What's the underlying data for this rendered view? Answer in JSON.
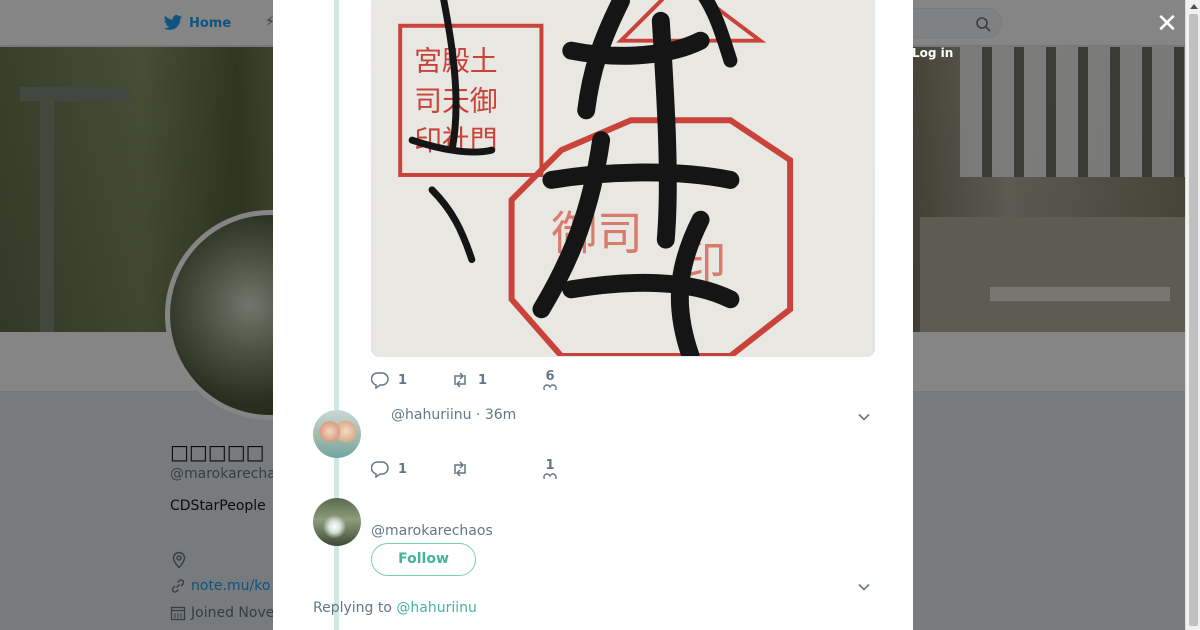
{
  "nav": {
    "home_label": "Home",
    "login_label": "Log in"
  },
  "profile": {
    "name": "□□□□□",
    "handle": "@marokarecha",
    "bio": "CDStarPeople",
    "link": "note.mu/ko",
    "joined": "Joined Nove"
  },
  "thread": {
    "tweet1": {
      "replies": "1",
      "retweets": "1",
      "likes": "6"
    },
    "tweet2": {
      "meta": "@hahuriinu · 36m",
      "replies": "1",
      "retweets": "",
      "likes": "1"
    },
    "main": {
      "handle": "@marokarechaos",
      "follow_label": "Follow",
      "replying_prefix": "Replying to",
      "replying_to": "@hahuriinu"
    }
  },
  "colors": {
    "accent": "#1da1f2",
    "follow_accent": "#43b59a",
    "thread_line": "#cfe9e2"
  },
  "icons": [
    "twitter-bird-icon",
    "search-icon",
    "close-icon",
    "reply-icon",
    "retweet-icon",
    "heart-icon",
    "chevron-down-icon",
    "location-icon",
    "link-icon",
    "calendar-icon"
  ]
}
